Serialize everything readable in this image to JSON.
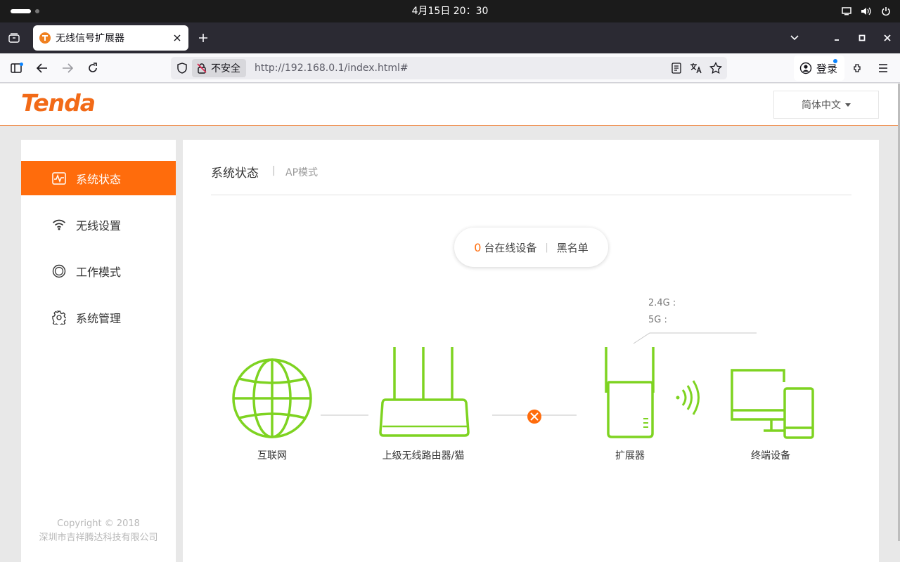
{
  "os": {
    "clock": "4月15日  20：30"
  },
  "browser": {
    "tab_title": "无线信号扩展器",
    "security_label": "不安全",
    "url": "http://192.168.0.1/index.html#",
    "login_label": "登录"
  },
  "header": {
    "logo": "Tenda",
    "language": "简体中文"
  },
  "sidebar": {
    "items": [
      {
        "label": "系统状态",
        "icon": "status-icon",
        "active": true
      },
      {
        "label": "无线设置",
        "icon": "wifi-icon",
        "active": false
      },
      {
        "label": "工作模式",
        "icon": "mode-icon",
        "active": false
      },
      {
        "label": "系统管理",
        "icon": "gear-icon",
        "active": false
      }
    ],
    "copyright_line1": "Copyright © 2018",
    "copyright_line2": "深圳市吉祥腾达科技有限公司"
  },
  "main": {
    "title": "系统状态",
    "separator": "|",
    "mode": "AP模式",
    "online_count": "0",
    "online_label": "台在线设备",
    "pill_separator": "|",
    "blacklist": "黑名单",
    "band_24": "2.4G :",
    "band_5": "5G :",
    "nodes": {
      "internet": "互联网",
      "router": "上级无线路由器/猫",
      "extender": "扩展器",
      "terminal": "终端设备"
    }
  },
  "colors": {
    "accent": "#ff6c0c",
    "device_green": "#7ed321",
    "error_orange": "#ff6c0c"
  }
}
